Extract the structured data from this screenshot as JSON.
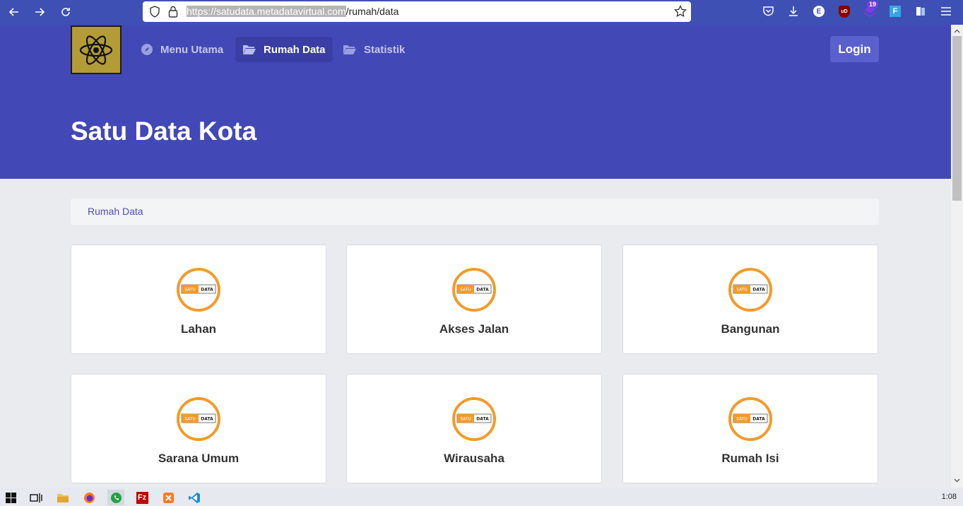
{
  "browser": {
    "url_host": "https://satudata.metadatavirtual.com",
    "url_path": "/rumah/data",
    "extension_badge": "19",
    "account_initial": "E",
    "ublock_label": "uD"
  },
  "navbar": {
    "items": [
      {
        "label": "Menu Utama",
        "icon": "compass-icon"
      },
      {
        "label": "Rumah Data",
        "icon": "folder-open-icon"
      },
      {
        "label": "Statistik",
        "icon": "folder-open-icon"
      }
    ],
    "login_label": "Login"
  },
  "hero": {
    "title": "Satu Data Kota"
  },
  "breadcrumb": {
    "current": "Rumah Data"
  },
  "emblem": {
    "left": "SATU",
    "right": "DATA"
  },
  "cards": [
    {
      "label": "Lahan"
    },
    {
      "label": "Akses Jalan"
    },
    {
      "label": "Bangunan"
    },
    {
      "label": "Sarana Umum"
    },
    {
      "label": "Wirausaha"
    },
    {
      "label": "Rumah Isi"
    }
  ],
  "taskbar": {
    "clock": "1:08"
  },
  "colors": {
    "accent": "#4348b7",
    "emblem_orange": "#f39a2b"
  }
}
